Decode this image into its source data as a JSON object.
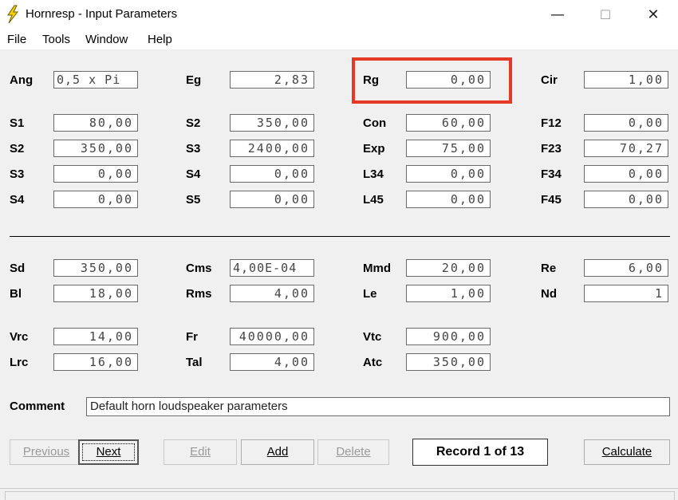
{
  "window": {
    "title": "Hornresp - Input Parameters",
    "minimize": "—",
    "maximize": "☐",
    "close": "✕"
  },
  "menu": [
    "File",
    "Tools",
    "Window",
    "Help"
  ],
  "params_top": [
    {
      "label": "Ang",
      "value": "0,5 x Pi"
    },
    {
      "label": "Eg",
      "value": "2,83"
    },
    {
      "label": "Rg",
      "value": "0,00"
    },
    {
      "label": "Cir",
      "value": "1,00"
    },
    {
      "label": "S1",
      "value": "80,00"
    },
    {
      "label": "S2",
      "value": "350,00"
    },
    {
      "label": "Con",
      "value": "60,00"
    },
    {
      "label": "F12",
      "value": "0,00"
    },
    {
      "label": "S2",
      "value": "350,00"
    },
    {
      "label": "S3",
      "value": "2400,00"
    },
    {
      "label": "Exp",
      "value": "75,00"
    },
    {
      "label": "F23",
      "value": "70,27"
    },
    {
      "label": "S3",
      "value": "0,00"
    },
    {
      "label": "S4",
      "value": "0,00"
    },
    {
      "label": "L34",
      "value": "0,00"
    },
    {
      "label": "F34",
      "value": "0,00"
    },
    {
      "label": "S4",
      "value": "0,00"
    },
    {
      "label": "S5",
      "value": "0,00"
    },
    {
      "label": "L45",
      "value": "0,00"
    },
    {
      "label": "F45",
      "value": "0,00"
    }
  ],
  "params_driver": [
    {
      "label": "Sd",
      "value": "350,00"
    },
    {
      "label": "Cms",
      "value": "4,00E-04"
    },
    {
      "label": "Mmd",
      "value": "20,00"
    },
    {
      "label": "Re",
      "value": "6,00"
    },
    {
      "label": "Bl",
      "value": "18,00"
    },
    {
      "label": "Rms",
      "value": "4,00"
    },
    {
      "label": "Le",
      "value": "1,00"
    },
    {
      "label": "Nd",
      "value": "1"
    },
    {
      "label": "Vrc",
      "value": "14,00"
    },
    {
      "label": "Fr",
      "value": "40000,00"
    },
    {
      "label": "Vtc",
      "value": "900,00"
    },
    {
      "label": "Lrc",
      "value": "16,00"
    },
    {
      "label": "Tal",
      "value": "4,00"
    },
    {
      "label": "Atc",
      "value": "350,00"
    }
  ],
  "comment": {
    "label": "Comment",
    "value": "Default horn loudspeaker parameters"
  },
  "buttons": {
    "previous": "Previous",
    "next": "Next",
    "edit": "Edit",
    "add": "Add",
    "delete": "Delete",
    "calculate": "Calculate"
  },
  "record": "Record 1 of 13",
  "colors": {
    "highlight": "#e43a24",
    "icon": "#f5d000"
  }
}
